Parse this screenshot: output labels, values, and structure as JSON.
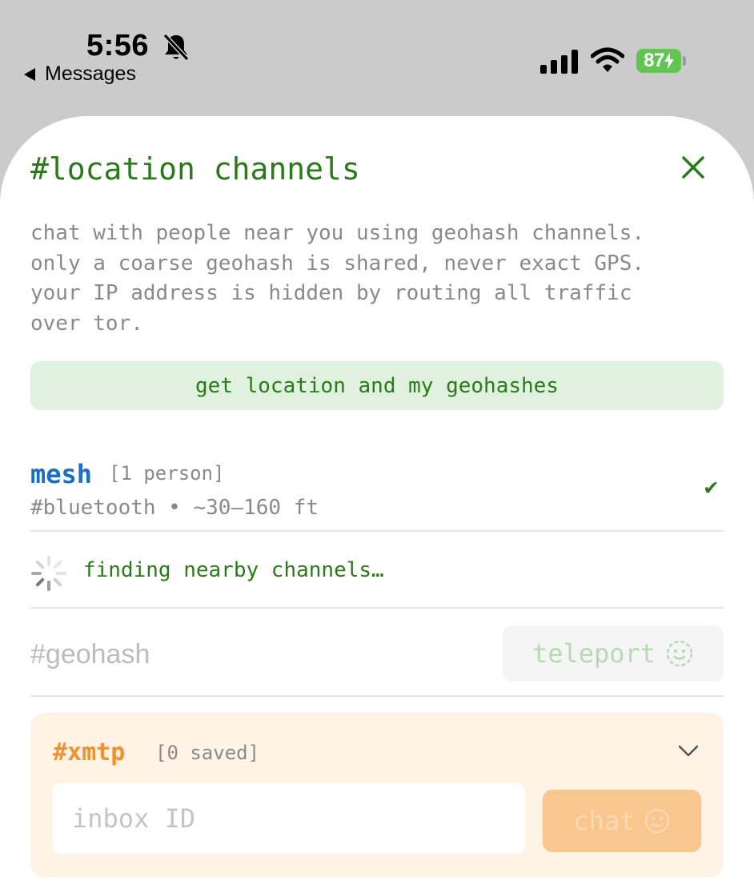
{
  "status_bar": {
    "time": "5:56",
    "back_label": "Messages",
    "battery": "87"
  },
  "sheet": {
    "title": "#location channels",
    "description": "chat with people near you using geohash channels.\nonly a coarse geohash is shared, never exact GPS.\nyour IP address is hidden by routing all traffic\nover tor.",
    "get_location_label": "get location and my geohashes"
  },
  "mesh": {
    "name": "mesh",
    "count": "[1 person]",
    "subtitle": "#bluetooth • ~30–160 ft",
    "check": "✔"
  },
  "finding": {
    "text": "finding nearby channels…"
  },
  "geohash": {
    "placeholder": "#geohash",
    "teleport_label": "teleport"
  },
  "xmtp": {
    "title": "#xmtp",
    "saved": "[0 saved]",
    "inbox_placeholder": "inbox ID",
    "chat_label": "chat"
  },
  "colors": {
    "green": "#2a7a1a",
    "blue": "#1a6fc4",
    "orange": "#f0922f",
    "battery_green": "#62c552"
  }
}
